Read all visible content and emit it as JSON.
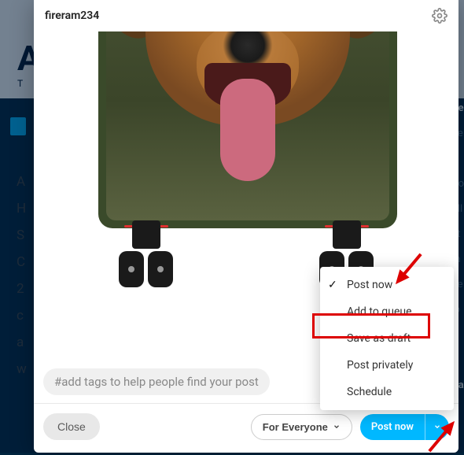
{
  "background": {
    "heading_letter": "A",
    "subheading_letter": "T",
    "left_letters": [
      "A",
      "H",
      "S",
      "C",
      "2",
      "c",
      "a",
      "w"
    ],
    "right_rows": [
      "ire",
      "ire",
      "Po",
      "oll",
      "ct",
      "ra",
      "ue",
      "lo",
      "a",
      "Ra"
    ]
  },
  "modal": {
    "username": "fireram234",
    "gear_icon": "settings",
    "tags_placeholder": "#add tags to help people find your post",
    "footer": {
      "close_label": "Close",
      "audience_label": "For Everyone",
      "post_label": "Post now"
    },
    "dropdown": {
      "items": [
        {
          "label": "Post now",
          "checked": true
        },
        {
          "label": "Add to queue",
          "checked": false
        },
        {
          "label": "Save as draft",
          "checked": false
        },
        {
          "label": "Post privately",
          "checked": false
        },
        {
          "label": "Schedule",
          "checked": false
        }
      ]
    }
  },
  "annotations": {
    "highlighted_option": "Save as draft"
  }
}
